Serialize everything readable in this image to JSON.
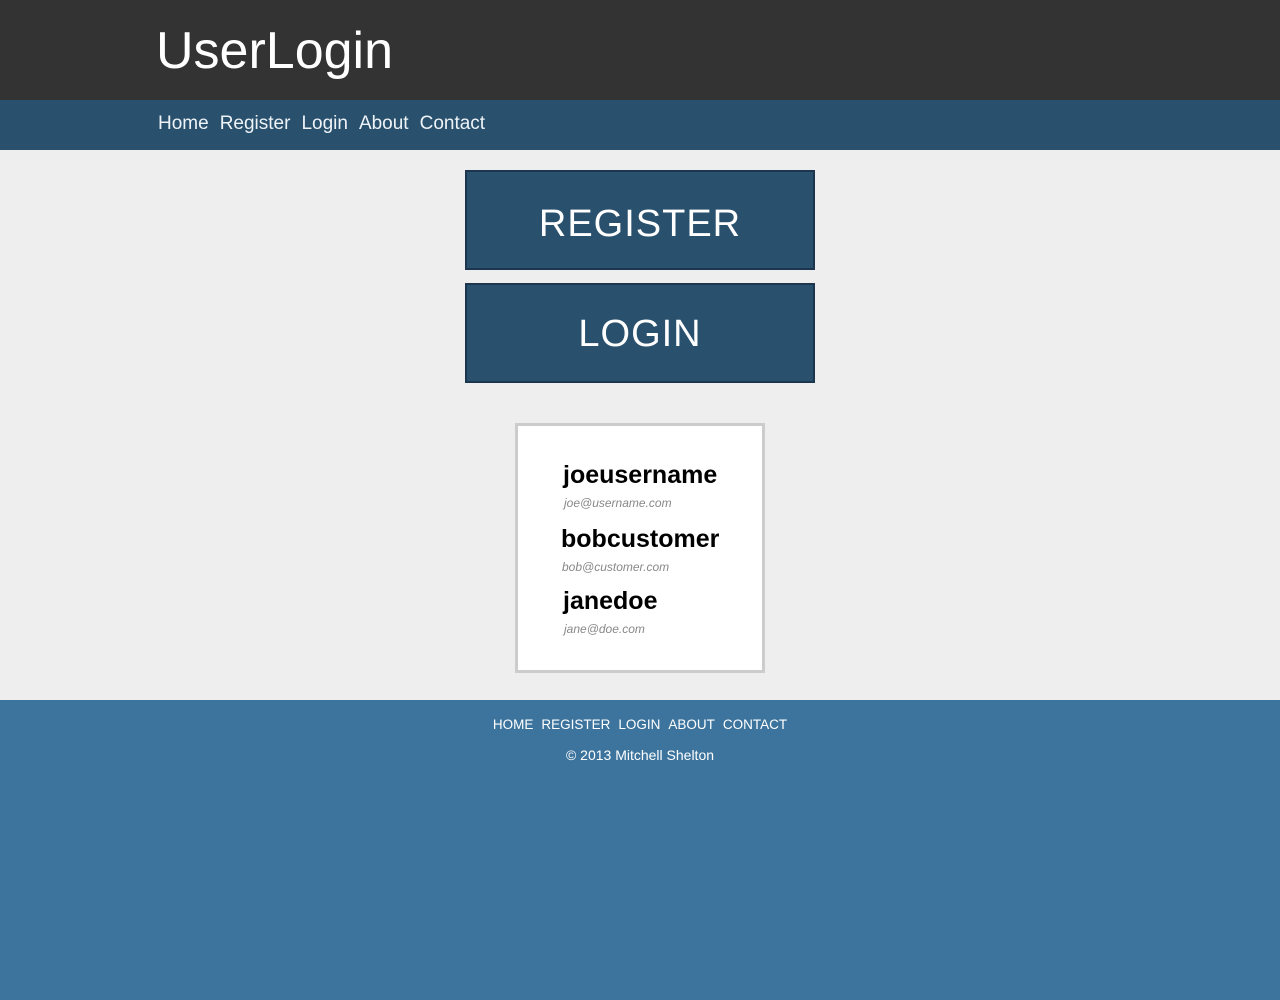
{
  "header": {
    "title": "UserLogin"
  },
  "nav": {
    "items": [
      {
        "label": "Home"
      },
      {
        "label": "Register"
      },
      {
        "label": "Login"
      },
      {
        "label": "About"
      },
      {
        "label": "Contact"
      }
    ]
  },
  "main": {
    "register_label": "REGISTER",
    "login_label": "LOGIN",
    "users": [
      {
        "username": "joeusername",
        "email": "joe@username.com"
      },
      {
        "username": "bobcustomer",
        "email": "bob@customer.com"
      },
      {
        "username": "janedoe",
        "email": "jane@doe.com"
      }
    ]
  },
  "footer": {
    "links": [
      {
        "label": "HOME"
      },
      {
        "label": "REGISTER"
      },
      {
        "label": "LOGIN"
      },
      {
        "label": "ABOUT"
      },
      {
        "label": "CONTACT"
      }
    ],
    "copyright": "© 2013 Mitchell Shelton"
  },
  "colors": {
    "header_bg": "#333333",
    "nav_bg": "#29506d",
    "button_bg": "#29506d",
    "page_bg": "#eeeeee",
    "footer_bg": "#3d749d"
  }
}
